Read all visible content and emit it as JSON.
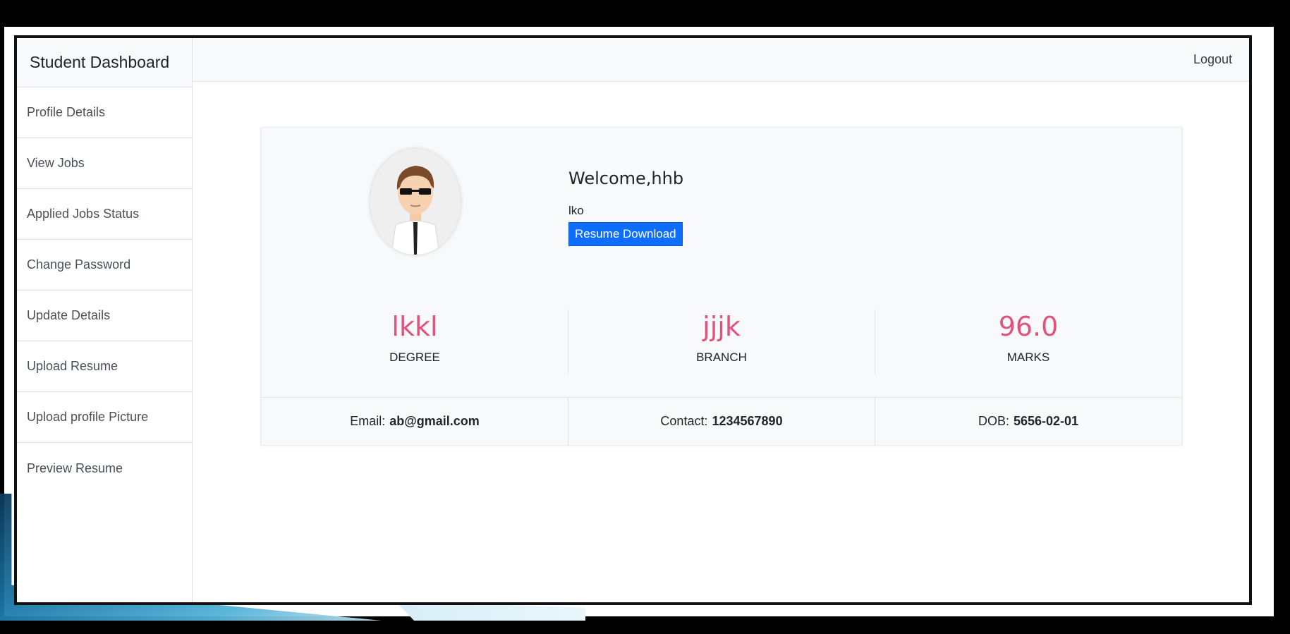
{
  "sidebar": {
    "heading": "Student Dashboard",
    "items": [
      {
        "label": "Profile Details"
      },
      {
        "label": "View Jobs"
      },
      {
        "label": "Applied Jobs Status"
      },
      {
        "label": "Change Password"
      },
      {
        "label": "Update Details"
      },
      {
        "label": "Upload Resume"
      },
      {
        "label": "Upload profile Picture"
      },
      {
        "label": "Preview Resume"
      }
    ]
  },
  "navbar": {
    "logout_label": "Logout"
  },
  "profile": {
    "welcome": "Welcome,hhb",
    "subtitle": "lko",
    "resume_button_label": "Resume Download",
    "avatar_icon": "cartoon-user-avatar"
  },
  "stats": [
    {
      "value": "lkkl",
      "label": "DEGREE"
    },
    {
      "value": "jjjk",
      "label": "BRANCH"
    },
    {
      "value": "96.0",
      "label": "MARKS"
    }
  ],
  "info": {
    "email_label": "Email:",
    "email_value": "ab@gmail.com",
    "contact_label": "Contact:",
    "contact_value": "1234567890",
    "dob_label": "DOB:",
    "dob_value": "5656-02-01"
  },
  "colors": {
    "accent_pink": "#e0537e",
    "button_blue": "#0d6efd",
    "panel_gray": "#f8f9fa"
  }
}
